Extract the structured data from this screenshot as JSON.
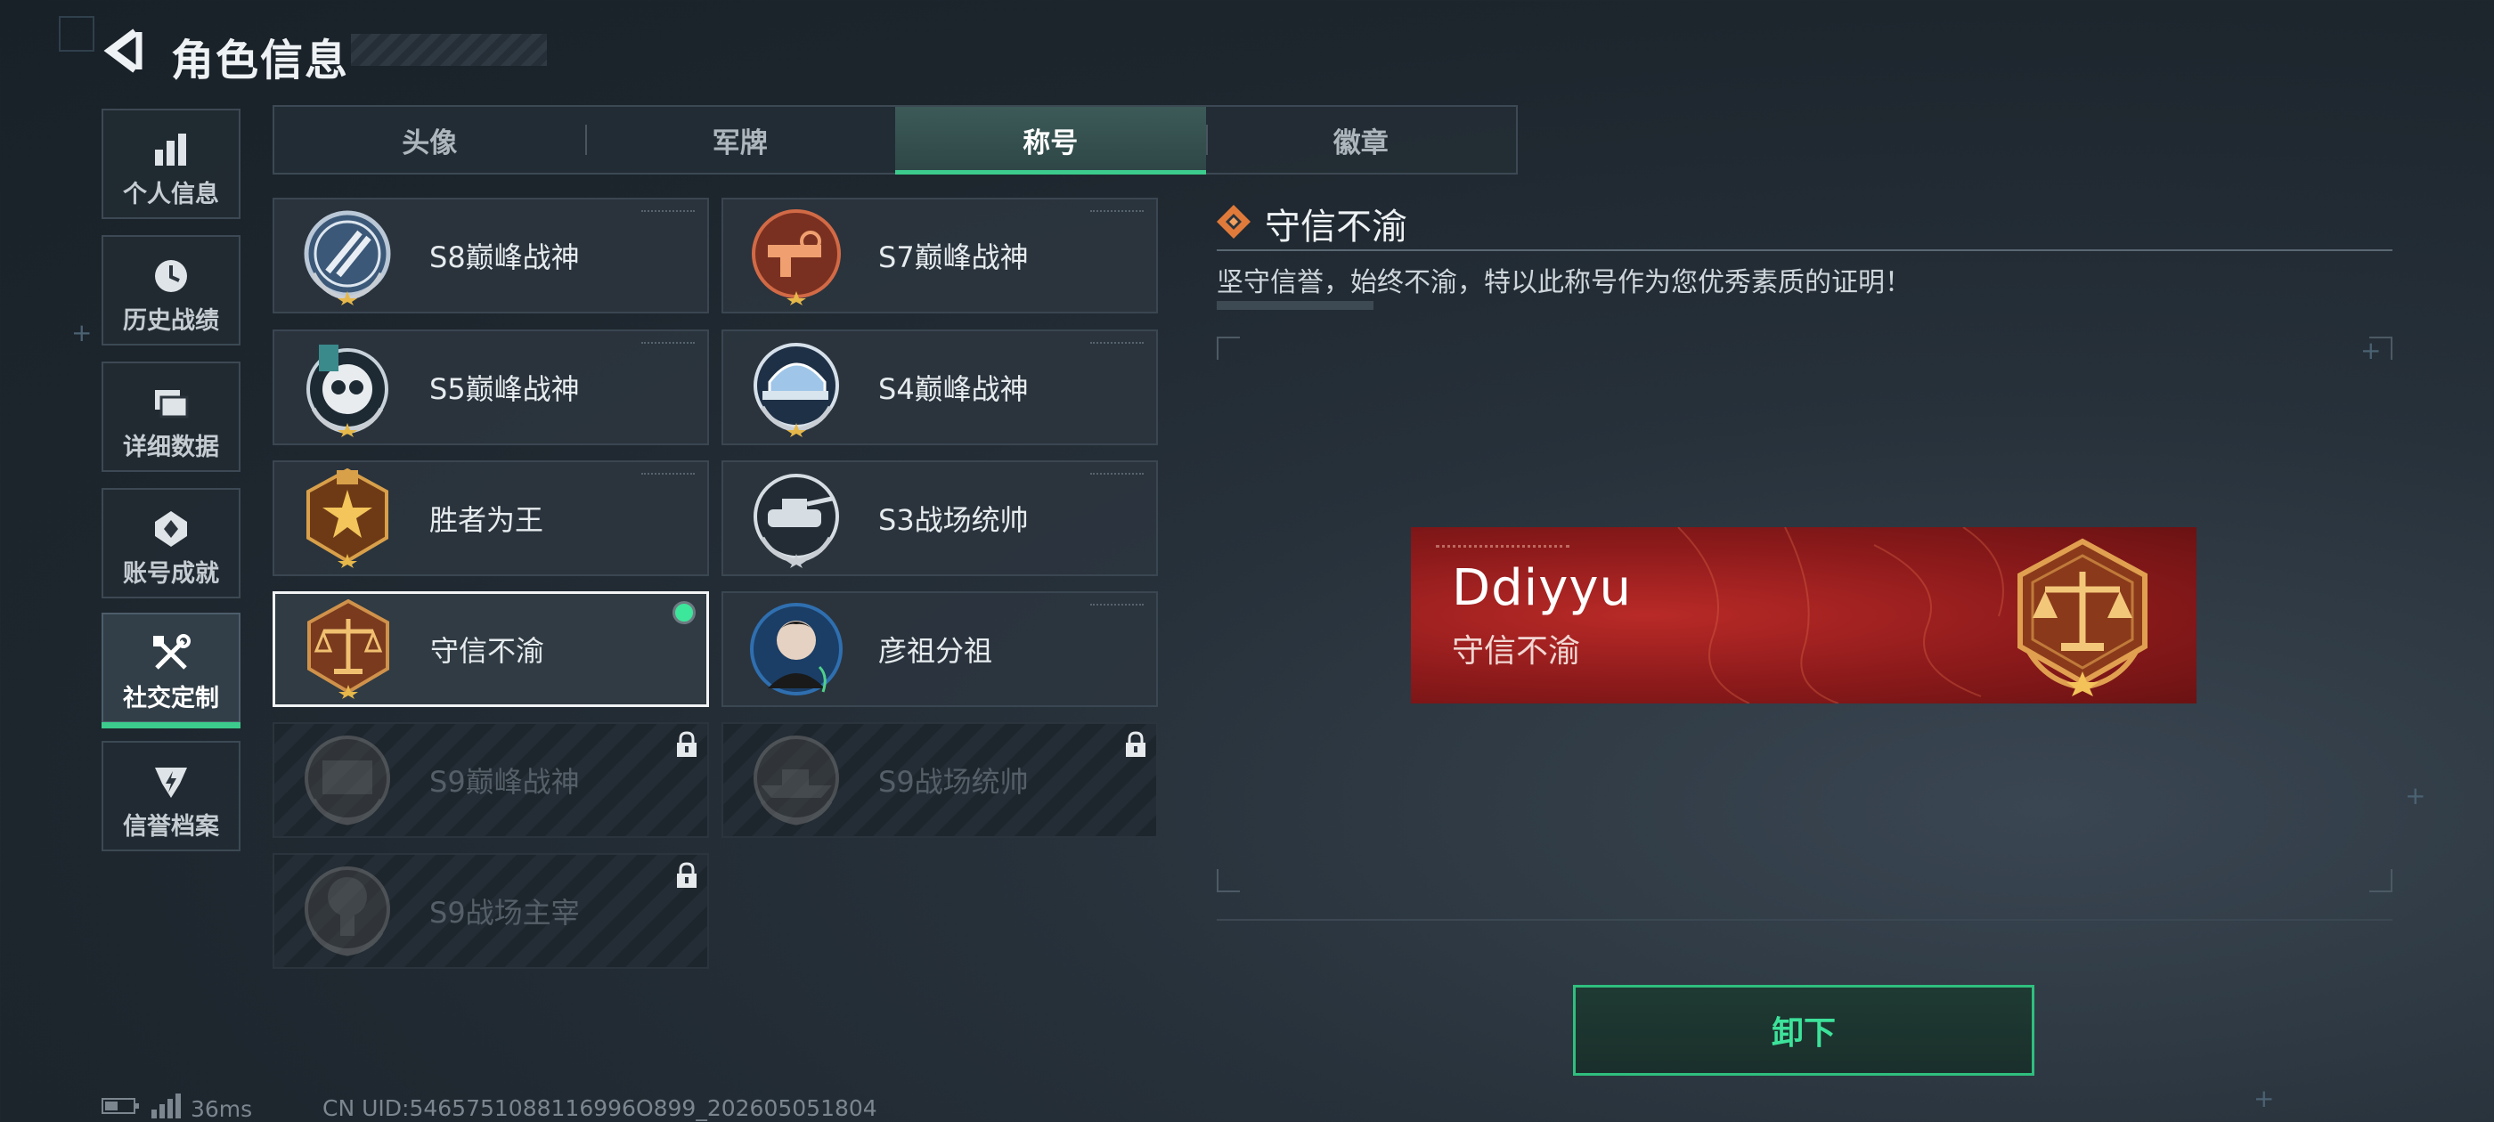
{
  "header": {
    "title": "角色信息",
    "back_icon": "back-arrow-icon"
  },
  "sidebar": {
    "items": [
      {
        "label": "个人信息",
        "icon": "bar-chart-icon",
        "active": false
      },
      {
        "label": "历史战绩",
        "icon": "clock-icon",
        "active": false
      },
      {
        "label": "详细数据",
        "icon": "folder-icon",
        "active": false
      },
      {
        "label": "账号成就",
        "icon": "achievement-icon",
        "active": false
      },
      {
        "label": "社交定制",
        "icon": "tools-icon",
        "active": true
      },
      {
        "label": "信誉档案",
        "icon": "shield-icon",
        "active": false
      }
    ]
  },
  "tabs": [
    {
      "label": "头像",
      "selected": false
    },
    {
      "label": "军牌",
      "selected": false
    },
    {
      "label": "称号",
      "selected": true
    },
    {
      "label": "徽章",
      "selected": false
    }
  ],
  "titles": [
    {
      "name": "S8巅峰战神",
      "icon": "s8-medal-icon",
      "state": "owned"
    },
    {
      "name": "S7巅峰战神",
      "icon": "s7-medal-icon",
      "state": "owned"
    },
    {
      "name": "S5巅峰战神",
      "icon": "s5-medal-icon",
      "state": "owned"
    },
    {
      "name": "S4巅峰战神",
      "icon": "s4-medal-icon",
      "state": "owned"
    },
    {
      "name": "胜者为王",
      "icon": "winner-medal-icon",
      "state": "owned"
    },
    {
      "name": "S3战场统帅",
      "icon": "s3-medal-icon",
      "state": "owned"
    },
    {
      "name": "守信不渝",
      "icon": "scales-medal-icon",
      "state": "equipped"
    },
    {
      "name": "彦祖分祖",
      "icon": "portrait-medal-icon",
      "state": "owned"
    },
    {
      "name": "S9巅峰战神",
      "icon": "s9-peak-medal-icon",
      "state": "locked"
    },
    {
      "name": "S9战场统帅",
      "icon": "s9-commander-medal-icon",
      "state": "locked"
    },
    {
      "name": "S9战场主宰",
      "icon": "s9-ruler-medal-icon",
      "state": "locked"
    }
  ],
  "detail": {
    "title": "守信不渝",
    "description": "坚守信誉，始终不渝，特以此称号作为您优秀素质的证明！"
  },
  "banner": {
    "player_name": "Ddiyyu",
    "title": "守信不渝"
  },
  "unequip_label": "卸下",
  "footer": {
    "latency": "36ms",
    "uid": "CN UID:5465751088116996O899_202605051804"
  },
  "colors": {
    "accent": "#3ccb8c",
    "banner_red": "#9b1f1f",
    "gold": "#c89a4a"
  }
}
